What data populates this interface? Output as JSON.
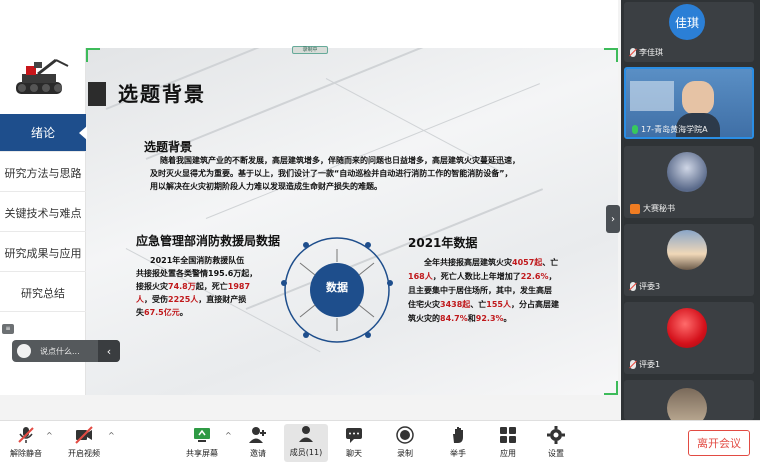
{
  "recording_badge": "录制中",
  "slide": {
    "title": "选题背景",
    "nav": [
      "绪论",
      "研究方法与思路",
      "关键技术与难点",
      "研究成果与应用",
      "研究总结"
    ],
    "section1": {
      "heading": "选题背景",
      "line1": "随着我国建筑产业的不断发展，高层建筑增多，伴随而来的问题也日益增多，高层建筑火灾蔓延迅速，",
      "line2": "及时灭火显得尤为重要。基于以上，我们设计了一款“自动巡检并自动进行消防工作的智能消防设备”，",
      "line3": "用以解决在火灾初期阶段人力难以发现造成生命财产损失的难题。"
    },
    "left_block": {
      "heading": "应急管理部消防救援局数据",
      "l1": "2021年全国消防救援队伍",
      "l2": "共接报处置各类警情195.6万起，",
      "l3a": "接报火灾",
      "l3b": "74.8万",
      "l3c": "起，死亡",
      "l3d": "1987",
      "l4a": "人",
      "l4b": "，受伤",
      "l4c": "2225人",
      "l4d": "，直接财产损",
      "l5a": "失",
      "l5b": "67.5亿元",
      "l5c": "。"
    },
    "center_label": "数据",
    "right_block": {
      "heading": "2021年数据",
      "l1a": "全年共接报高层建筑火灾",
      "l1b": "4057起",
      "l1c": "、亡",
      "l2a": "168人",
      "l2b": "，死亡人数比上年增加了",
      "l2c": "22.6%",
      "l2d": "，",
      "l3": "且主要集中于居住场所，其中，发生高层",
      "l4a": "住宅火灾",
      "l4b": "3438起",
      "l4c": "、亡",
      "l4d": "155人",
      "l4e": "，分占高层建",
      "l5a": "筑火灾的",
      "l5b": "84.7%",
      "l5c": "和",
      "l5d": "92.3%",
      "l5e": "。"
    },
    "chat_placeholder": "说点什么..."
  },
  "participants": [
    {
      "name": "李佳琪",
      "avatar_text": "佳琪",
      "mic": "off",
      "type": "text-avatar",
      "color": "#2b7fd6"
    },
    {
      "name": "17-青岛黄海学院A",
      "mic": "on",
      "type": "video",
      "active": true
    },
    {
      "name": "大赛秘书",
      "mic": "host",
      "type": "image-avatar"
    },
    {
      "name": "评委3",
      "mic": "off",
      "type": "image-avatar"
    },
    {
      "name": "评委1",
      "mic": "off",
      "type": "image-avatar"
    },
    {
      "name": "",
      "mic": "",
      "type": "image-avatar"
    }
  ],
  "toolbar": {
    "unmute": "解除静音",
    "video": "开启视频",
    "share": "共享屏幕",
    "invite": "邀请",
    "members": "成员(11)",
    "chat": "聊天",
    "record": "录制",
    "raise": "举手",
    "apps": "应用",
    "settings": "设置",
    "leave": "离开会议"
  },
  "colors": {
    "accent_blue": "#1e4e8c",
    "highlight_red": "#c0191c",
    "leave_red": "#e24b43",
    "panel_dark": "#2f3336"
  }
}
